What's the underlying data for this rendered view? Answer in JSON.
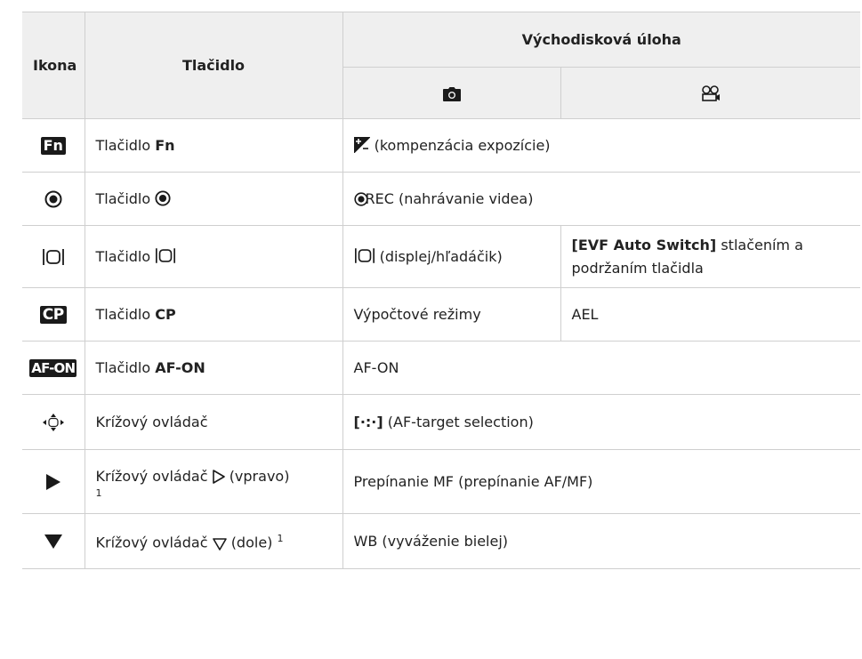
{
  "header": {
    "col_icon": "Ikona",
    "col_button": "Tlačidlo",
    "col_default": "Východisková úloha",
    "sub_photo_icon": "camera-icon",
    "sub_movie_icon": "movie-camera-icon"
  },
  "rows": [
    {
      "icon": "fn-button-icon",
      "icon_text": "Fn",
      "button_prefix": "Tlačidlo",
      "button_bold": "Fn",
      "default": "(kompenzácia expozície)"
    },
    {
      "icon": "record-button-icon",
      "button_prefix": "Tlačidlo",
      "default": "REC (nahrávanie videa)"
    },
    {
      "icon": "display-switch-icon",
      "button_prefix": "Tlačidlo",
      "photo": "(displej/hľadáčik)",
      "movie_bold": "[EVF Auto Switch]",
      "movie_rest": "stlačením a podržaním tlačidla"
    },
    {
      "icon": "cp-button-icon",
      "icon_text": "CP",
      "button_prefix": "Tlačidlo",
      "button_bold": "CP",
      "photo": "Výpočtové režimy",
      "movie": "AEL"
    },
    {
      "icon": "af-on-button-icon",
      "icon_text": "AF-ON",
      "button_prefix": "Tlačidlo",
      "button_bold": "AF-ON",
      "default": "AF-ON"
    },
    {
      "icon": "multi-selector-icon",
      "button": "Krížový ovládač",
      "default_bold": "[·:·]",
      "default": "(AF-target selection)"
    },
    {
      "icon": "right-arrow-icon",
      "button_prefix": "Krížový ovládač",
      "button_suffix": "(vpravo)",
      "footnote": "1",
      "default": "Prepínanie MF (prepínanie AF/MF)"
    },
    {
      "icon": "down-arrow-icon",
      "button_prefix": "Krížový ovládač",
      "button_suffix": "(dole)",
      "footnote": "1",
      "default": "WB (vyváženie bielej)"
    }
  ]
}
